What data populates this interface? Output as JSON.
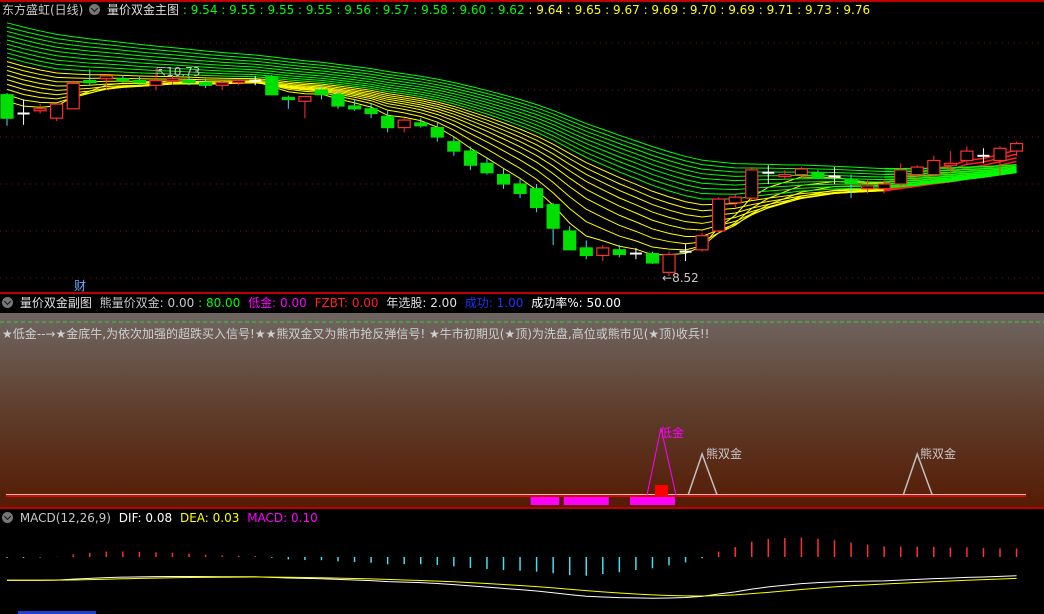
{
  "main_header": {
    "stock": "东方盛虹(日线)",
    "indicator": "量价双金主图",
    "ma_values": [
      "9.54",
      "9.55",
      "9.55",
      "9.55",
      "9.56",
      "9.57",
      "9.58",
      "9.60",
      "9.62",
      "9.64",
      "9.65",
      "9.67",
      "9.69",
      "9.70",
      "9.69",
      "9.71",
      "9.73",
      "9.76"
    ],
    "ma_colors": [
      "#00ff00",
      "#00ff00",
      "#00ff00",
      "#00ff00",
      "#00ff00",
      "#00ff00",
      "#00ff00",
      "#00ff00",
      "#00ff00",
      "#ffff00",
      "#ffff00",
      "#ffff00",
      "#ffff00",
      "#ffff00",
      "#ffff00",
      "#ffff00",
      "#ffff00",
      "#ffff00"
    ]
  },
  "main_labels": {
    "high": "10.73",
    "low": "8.52",
    "finance_marker": "财"
  },
  "sub_header": {
    "indicator": "量价双金副图",
    "f1_label": "熊量价双金:",
    "f1_value": "0.00",
    "f2_value": ": 80.00",
    "f3_label": "低金:",
    "f3_value": "0.00",
    "f4_label": "FZBT:",
    "f4_value": "0.00",
    "f5_label": "年选股:",
    "f5_value": "2.00",
    "f6_label": "成功:",
    "f6_value": "1.00",
    "f7_label": "成功率%:",
    "f7_value": "50.00"
  },
  "sub_text": "★低金--→★金底牛,为依次加强的超跌买入信号!★★熊双金叉为熊市抢反弹信号! ★牛市初期见(★顶)为洗盘,高位或熊市见(★顶)收兵!!",
  "sub_signals": {
    "low_gold": "低金",
    "bear_double_gold_1": "熊双金",
    "bear_double_gold_2": "熊双金"
  },
  "macd_header": {
    "name": "MACD(12,26,9)",
    "dif": "DIF: 0.08",
    "dea": "DEA: 0.03",
    "macd": "MACD: 0.10"
  },
  "colors": {
    "up": "#ff3030",
    "down": "#00e000",
    "dif": "#ffffff",
    "dea": "#ffff00",
    "macd_pos": "#ff3030",
    "macd_neg": "#40e0f0",
    "signal": "#ff00ff"
  },
  "chart_data": {
    "type": "candlestick",
    "title": "东方盛虹(日线) 量价双金主图",
    "ylim": [
      8.4,
      11.3
    ],
    "high_label": 10.73,
    "low_label": 8.52,
    "ohlc": [
      [
        10.45,
        10.47,
        10.12,
        10.2
      ],
      [
        10.25,
        10.4,
        10.13,
        10.25
      ],
      [
        10.28,
        10.35,
        10.25,
        10.3
      ],
      [
        10.2,
        10.36,
        10.17,
        10.35
      ],
      [
        10.3,
        10.6,
        10.3,
        10.57
      ],
      [
        10.6,
        10.72,
        10.55,
        10.58
      ],
      [
        10.62,
        10.66,
        10.5,
        10.65
      ],
      [
        10.62,
        10.66,
        10.58,
        10.6
      ],
      [
        10.6,
        10.64,
        10.56,
        10.58
      ],
      [
        10.55,
        10.73,
        10.5,
        10.6
      ],
      [
        10.6,
        10.66,
        10.56,
        10.62
      ],
      [
        10.6,
        10.65,
        10.55,
        10.58
      ],
      [
        10.58,
        10.62,
        10.52,
        10.55
      ],
      [
        10.55,
        10.6,
        10.5,
        10.58
      ],
      [
        10.58,
        10.62,
        10.55,
        10.6
      ],
      [
        10.6,
        10.65,
        10.55,
        10.6
      ],
      [
        10.64,
        10.66,
        10.45,
        10.45
      ],
      [
        10.42,
        10.44,
        10.3,
        10.4
      ],
      [
        10.38,
        10.42,
        10.2,
        10.43
      ],
      [
        10.5,
        10.55,
        10.4,
        10.45
      ],
      [
        10.45,
        10.5,
        10.3,
        10.33
      ],
      [
        10.33,
        10.4,
        10.28,
        10.3
      ],
      [
        10.3,
        10.36,
        10.2,
        10.25
      ],
      [
        10.22,
        10.28,
        10.05,
        10.1
      ],
      [
        10.1,
        10.2,
        10.05,
        10.18
      ],
      [
        10.15,
        10.2,
        10.1,
        10.12
      ],
      [
        10.1,
        10.15,
        9.95,
        10.0
      ],
      [
        9.95,
        10.0,
        9.8,
        9.85
      ],
      [
        9.85,
        9.9,
        9.65,
        9.7
      ],
      [
        9.72,
        9.78,
        9.6,
        9.62
      ],
      [
        9.6,
        9.66,
        9.45,
        9.5
      ],
      [
        9.5,
        9.55,
        9.35,
        9.4
      ],
      [
        9.45,
        9.5,
        9.2,
        9.25
      ],
      [
        9.28,
        9.3,
        8.85,
        9.03
      ],
      [
        9.0,
        9.05,
        8.8,
        8.8
      ],
      [
        8.82,
        8.9,
        8.7,
        8.74
      ],
      [
        8.74,
        8.85,
        8.68,
        8.82
      ],
      [
        8.8,
        8.85,
        8.72,
        8.75
      ],
      [
        8.76,
        8.82,
        8.7,
        8.76
      ],
      [
        8.76,
        8.78,
        8.65,
        8.66
      ],
      [
        8.56,
        8.78,
        8.52,
        8.75
      ],
      [
        8.78,
        8.86,
        8.68,
        8.78
      ],
      [
        8.8,
        8.98,
        8.78,
        8.95
      ],
      [
        9.0,
        9.36,
        8.98,
        9.34
      ],
      [
        9.3,
        9.4,
        9.25,
        9.36
      ],
      [
        9.35,
        9.68,
        9.33,
        9.65
      ],
      [
        9.62,
        9.7,
        9.5,
        9.62
      ],
      [
        9.58,
        9.65,
        9.55,
        9.6
      ],
      [
        9.6,
        9.68,
        9.58,
        9.66
      ],
      [
        9.62,
        9.65,
        9.55,
        9.56
      ],
      [
        9.58,
        9.68,
        9.5,
        9.58
      ],
      [
        9.55,
        9.6,
        9.35,
        9.5
      ],
      [
        9.45,
        9.55,
        9.4,
        9.48
      ],
      [
        9.45,
        9.55,
        9.4,
        9.5
      ],
      [
        9.5,
        9.72,
        9.48,
        9.65
      ],
      [
        9.6,
        9.7,
        9.55,
        9.68
      ],
      [
        9.6,
        9.8,
        9.58,
        9.75
      ],
      [
        9.7,
        9.85,
        9.62,
        9.72
      ],
      [
        9.75,
        9.9,
        9.7,
        9.85
      ],
      [
        9.8,
        9.88,
        9.72,
        9.8
      ],
      [
        9.75,
        9.9,
        9.6,
        9.88
      ],
      [
        9.85,
        9.95,
        9.8,
        9.93
      ]
    ],
    "sub_signal_bars": [
      {
        "type": "magenta",
        "from": 32,
        "to": 33
      },
      {
        "type": "magenta",
        "from": 34,
        "to": 36
      },
      {
        "type": "magenta",
        "from": 38,
        "to": 40
      },
      {
        "type": "red",
        "from": 39,
        "to": 39
      }
    ],
    "sub_triangles": [
      {
        "type": "low_gold",
        "index": 40
      },
      {
        "type": "bear_double_gold",
        "index": 42
      },
      {
        "type": "bear_double_gold",
        "index": 55
      }
    ]
  }
}
